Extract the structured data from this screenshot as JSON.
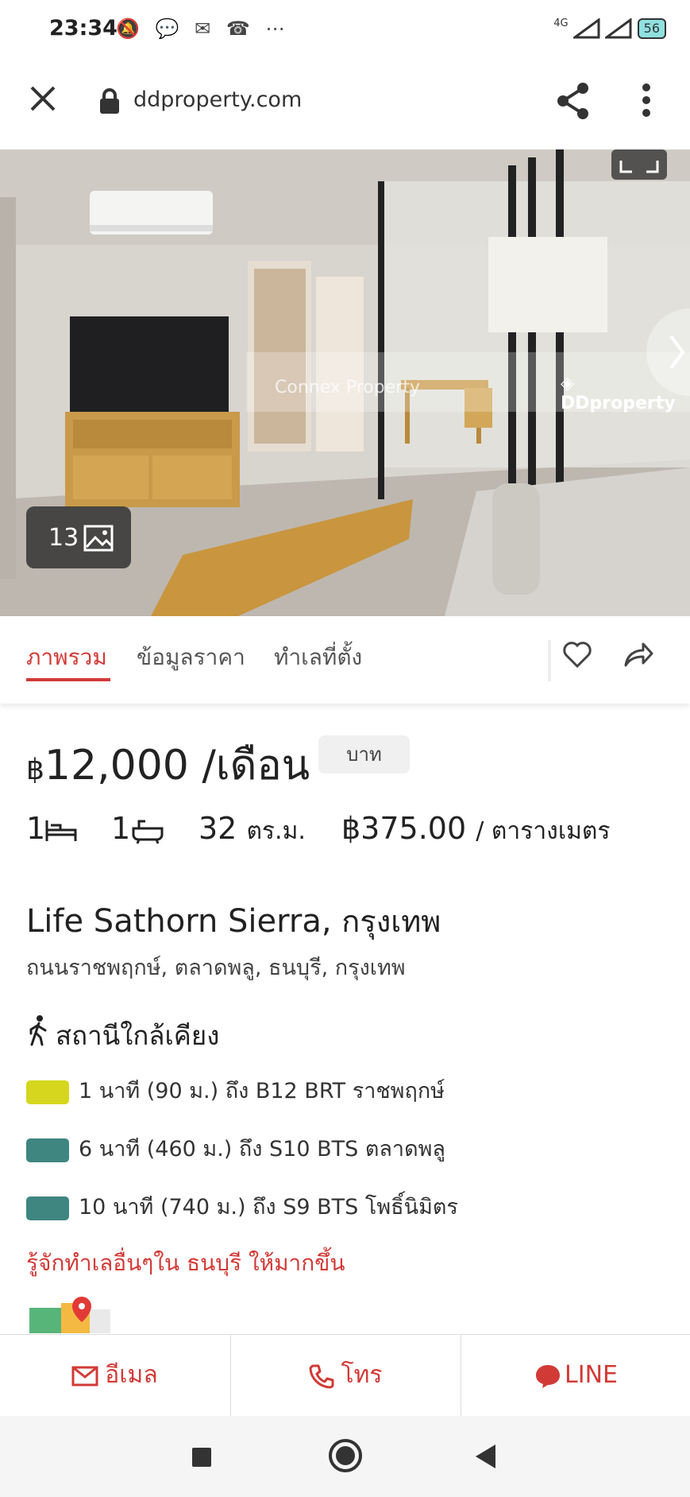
{
  "status_bar": {
    "time": "23:34",
    "network": "4G",
    "battery": "56"
  },
  "browser": {
    "domain": "ddproperty.com"
  },
  "hero": {
    "watermark": "Connex Property",
    "brand_logo_text": "DDproperty",
    "photo_count": "13"
  },
  "tabs": [
    {
      "label": "ภาพรวม"
    },
    {
      "label": "ข้อมูลราคา"
    },
    {
      "label": "ทำเลที่ตั้ง"
    }
  ],
  "listing": {
    "currency_symbol": "฿",
    "price": "12,000",
    "price_period": "/เดือน",
    "currency_badge": "บาท",
    "bedrooms": "1",
    "bathrooms": "1",
    "area": "32",
    "area_unit": "ตร.ม.",
    "price_per_sqm": "฿375.00",
    "price_per_sqm_unit": "/ ตารางเมตร",
    "project_name": "Life Sathorn Sierra,",
    "city": "กรุงเทพ",
    "address": "ถนนราชพฤกษ์, ตลาดพลู, ธนบุรี, กรุงเทพ"
  },
  "nearby": {
    "heading": "สถานีใกล้เคียง",
    "stations": [
      {
        "text": "1 นาที (90 ม.) ถึง B12 BRT ราชพฤกษ์",
        "color": "#d6d61e"
      },
      {
        "text": "6 นาที (460 ม.) ถึง S10 BTS ตลาดพลู",
        "color": "#3f8680"
      },
      {
        "text": "10 นาที (740 ม.) ถึง S9 BTS โพธิ์นิมิตร",
        "color": "#3f8680"
      }
    ],
    "learn_more": "รู้จักทำเลอื่นๆใน ธนบุรี ให้มากขึ้น"
  },
  "actions": {
    "email": "อีเมล",
    "call": "โทร",
    "line": "LINE"
  },
  "colors": {
    "accent": "#d23a36"
  }
}
